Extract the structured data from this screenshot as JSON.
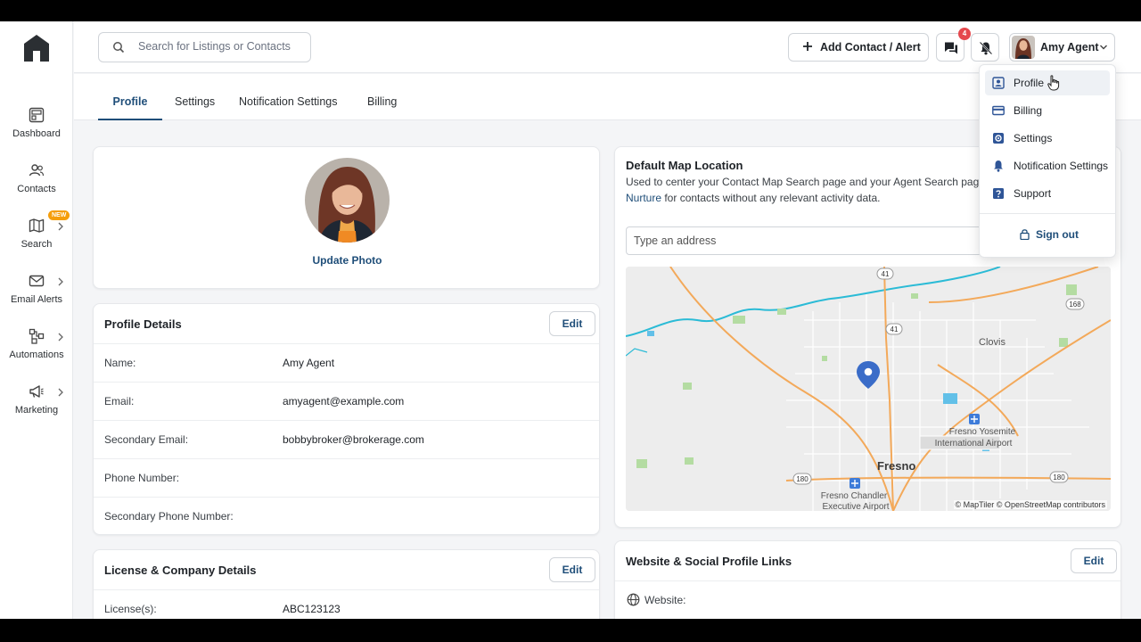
{
  "sidebar": {
    "items": [
      {
        "label": "Dashboard",
        "icon": "dashboard-icon"
      },
      {
        "label": "Contacts",
        "icon": "contacts-icon"
      },
      {
        "label": "Search",
        "icon": "map-icon",
        "badge": "NEW"
      },
      {
        "label": "Email Alerts",
        "icon": "mail-icon"
      },
      {
        "label": "Automations",
        "icon": "automations-icon"
      },
      {
        "label": "Marketing",
        "icon": "megaphone-icon"
      }
    ]
  },
  "header": {
    "search_placeholder": "Search for Listings or Contacts",
    "add_button_label": "Add Contact / Alert",
    "messages_count": "4",
    "user_name": "Amy Agent"
  },
  "tabs": [
    {
      "label": "Profile",
      "active": true
    },
    {
      "label": "Settings",
      "active": false
    },
    {
      "label": "Notification Settings",
      "active": false
    },
    {
      "label": "Billing",
      "active": false
    }
  ],
  "photo_card": {
    "update_label": "Update Photo"
  },
  "profile_details": {
    "title": "Profile Details",
    "edit_label": "Edit",
    "rows": [
      {
        "label": "Name:",
        "value": "Amy Agent"
      },
      {
        "label": "Email:",
        "value": "amyagent@example.com"
      },
      {
        "label": "Secondary Email:",
        "value": "bobbybroker@brokerage.com"
      },
      {
        "label": "Phone Number:",
        "value": ""
      },
      {
        "label": "Secondary Phone Number:",
        "value": ""
      }
    ]
  },
  "license_details": {
    "title": "License & Company Details",
    "edit_label": "Edit",
    "rows": [
      {
        "label": "License(s):",
        "value": "ABC123123"
      }
    ]
  },
  "map_card": {
    "title": "Default Map Location",
    "description_line1": "Used to center your Contact Map Search page and your Agent Search page",
    "description_link": "Nurture",
    "description_line2": " for contacts without any relevant activity data.",
    "address_placeholder": "Type an address",
    "attribution": "© MapTiler © OpenStreetMap contributors",
    "labels": {
      "city_main": "Fresno",
      "city_clovis": "Clovis",
      "airport1_line1": "Fresno Yosemite",
      "airport1_line2": "International Airport",
      "airport2_line1": "Fresno Chandler",
      "airport2_line2": "Executive Airport",
      "hw_41a": "41",
      "hw_41b": "41",
      "hw_168": "168",
      "hw_180a": "180",
      "hw_180b": "180"
    }
  },
  "social_card": {
    "title": "Website & Social Profile Links",
    "edit_label": "Edit",
    "website_label": "Website:"
  },
  "user_menu": {
    "items": [
      {
        "label": "Profile",
        "icon": "profile-icon",
        "active": true
      },
      {
        "label": "Billing",
        "icon": "credit-card-icon",
        "active": false
      },
      {
        "label": "Settings",
        "icon": "settings-icon",
        "active": false
      },
      {
        "label": "Notification Settings",
        "icon": "bell-icon",
        "active": false
      },
      {
        "label": "Support",
        "icon": "help-icon",
        "active": false
      }
    ],
    "sign_out_label": "Sign out"
  },
  "colors": {
    "accent": "#1f4e79",
    "badge_red": "#e5484d",
    "new_badge": "#f59e0b"
  }
}
